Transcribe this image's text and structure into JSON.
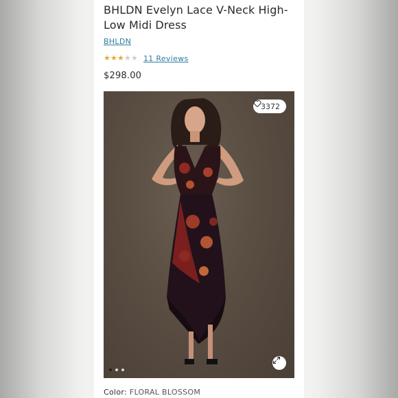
{
  "product": {
    "title": "BHLDN Evelyn Lace V-Neck High-Low Midi Dress",
    "brand": "BHLDN",
    "rating": 3,
    "rating_max": 5,
    "reviews_label": "11 Reviews",
    "price": "$298.00"
  },
  "gallery": {
    "like_count": "3372",
    "like_icon": "heart-icon",
    "expand_icon": "expand-icon",
    "slide_count": 3,
    "active_slide": 1
  },
  "details": {
    "color_label": "Color:",
    "color_value": "FLORAL BLOSSOM"
  },
  "colors": {
    "link": "#2f7aa0",
    "star": "#e3a93b",
    "text": "#2a2a2a"
  }
}
